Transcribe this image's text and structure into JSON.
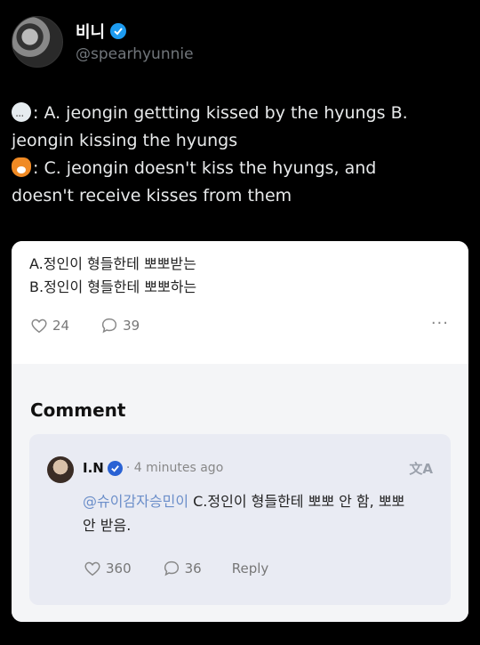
{
  "tweet": {
    "display_name": "비니",
    "handle": "@spearhyunnie",
    "lines": [
      ": A. jeongin gettting kissed by the hyungs B.",
      "jeongin kissing the hyungs",
      ": C. jeongin doesn't kiss the hyungs, and",
      "doesn't receive kisses from them"
    ],
    "icons": [
      "speech-bubble-emoji",
      "fox-emoji"
    ]
  },
  "post": {
    "option_a": "A.정인이 형들한테 뽀뽀받는",
    "option_b": "B.정인이 형들한테 뽀뽀하는",
    "likes": "24",
    "comments": "39",
    "more": "···"
  },
  "comments_section": {
    "title": "Comment",
    "comment": {
      "author": "I.N",
      "time": "· 4 minutes ago",
      "translate_icon": "文A",
      "mention": "@슈이감자승민이",
      "text_line1": " C.정인이 형들한테 뽀뽀 안 함, 뽀뽀",
      "text_line2": "안 받음.",
      "likes": "360",
      "replies": "36",
      "reply_label": "Reply"
    }
  },
  "colors": {
    "background": "#000000",
    "verified_blue": "#1d9bf0",
    "card": "#ffffff",
    "comment_box": "#e9ebf3"
  }
}
